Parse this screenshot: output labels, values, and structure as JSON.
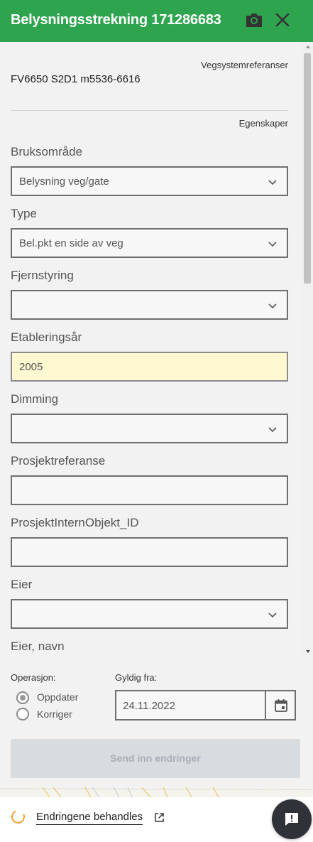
{
  "header": {
    "title": "Belysningsstrekning 171286683",
    "camera_icon": "camera-icon",
    "close_icon": "close-icon"
  },
  "sections": {
    "vegsystem_label": "Vegsystemreferanser",
    "vegsystem_value": "FV6650 S2D1 m5536-6616",
    "egenskaper_label": "Egenskaper"
  },
  "fields": [
    {
      "label": "Bruksområde",
      "value": "Belysning veg/gate",
      "type": "select"
    },
    {
      "label": "Type",
      "value": "Bel.pkt en side av veg",
      "type": "select"
    },
    {
      "label": "Fjernstyring",
      "value": "",
      "type": "select"
    },
    {
      "label": "Etableringsår",
      "value": "2005",
      "type": "text",
      "highlight": "#fff8d0"
    },
    {
      "label": "Dimming",
      "value": "",
      "type": "select"
    },
    {
      "label": "Prosjektreferanse",
      "value": "",
      "type": "text"
    },
    {
      "label": "ProsjektInternObjekt_ID",
      "value": "",
      "type": "text"
    },
    {
      "label": "Eier",
      "value": "",
      "type": "select"
    },
    {
      "label": "Eier, navn",
      "value": "",
      "type": "text"
    }
  ],
  "operation": {
    "label": "Operasjon:",
    "options": [
      {
        "label": "Oppdater",
        "selected": true
      },
      {
        "label": "Korriger",
        "selected": false
      }
    ]
  },
  "valid_from": {
    "label": "Gyldig fra:",
    "value": "24.11.2022",
    "icon": "calendar-icon"
  },
  "submit_label": "Send inn endringer",
  "status": {
    "text": "Endringene behandles",
    "icon": "external-link-icon",
    "spinner_color": "#f0a030"
  },
  "colors": {
    "header": "#2ea44f",
    "panel": "#f2f2f2",
    "fab": "#2f3338"
  }
}
